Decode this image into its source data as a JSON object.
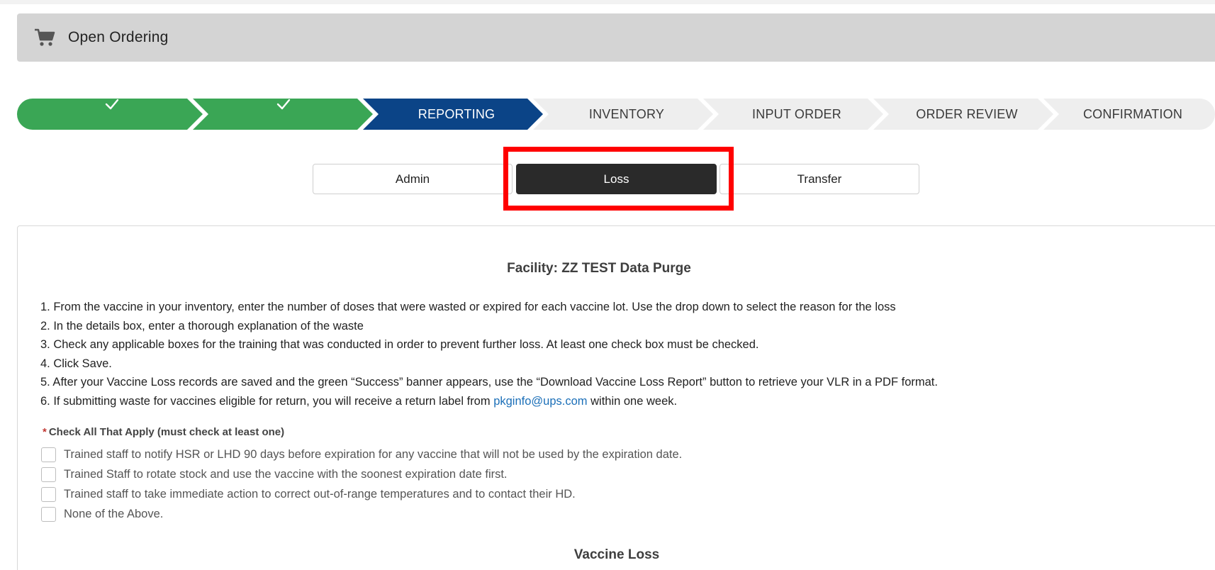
{
  "header": {
    "title": "Open Ordering",
    "icon": "cart-icon"
  },
  "stepper": {
    "steps": [
      {
        "label": "",
        "state": "complete"
      },
      {
        "label": "",
        "state": "complete"
      },
      {
        "label": "REPORTING",
        "state": "active"
      },
      {
        "label": "INVENTORY",
        "state": "upcoming"
      },
      {
        "label": "INPUT ORDER",
        "state": "upcoming"
      },
      {
        "label": "ORDER REVIEW",
        "state": "upcoming"
      },
      {
        "label": "CONFIRMATION",
        "state": "upcoming"
      }
    ],
    "colors": {
      "complete": "#3aa655",
      "active": "#0b4487",
      "upcoming": "#eeeeee"
    }
  },
  "tabs": [
    {
      "label": "Admin",
      "selected": false
    },
    {
      "label": "Loss",
      "selected": true
    },
    {
      "label": "Transfer",
      "selected": false
    }
  ],
  "highlight_color": "#ff0000",
  "main": {
    "facility": "Facility: ZZ TEST Data Purge",
    "instructions": [
      "1. From the vaccine in your inventory, enter the number of doses that were wasted or expired for each vaccine lot. Use the drop down to select the reason for the loss",
      "2. In the details box, enter a thorough explanation of the waste",
      "3. Check any applicable boxes for the training that was conducted in order to prevent further loss. At least one check box must be checked.",
      "4. Click Save.",
      "5. After your Vaccine Loss records are saved and the green “Success” banner appears, use the “Download Vaccine Loss Report” button to retrieve your VLR in a PDF format."
    ],
    "instruction6": {
      "before": "6. If submitting waste for vaccines eligible for return, you will receive a return label from ",
      "link": "pkginfo@ups.com",
      "after": " within one week."
    },
    "checks_heading": {
      "required_mark": "*",
      "text": "Check All That Apply (must check at least one)"
    },
    "checks": [
      "Trained staff to notify HSR or LHD 90 days before expiration for any vaccine that will not be used by the expiration date.",
      "Trained Staff to rotate stock and use the vaccine with the soonest expiration date first.",
      "Trained staff to take immediate action to correct out-of-range temperatures and to contact their HD.",
      "None of the Above."
    ],
    "section_title": "Vaccine Loss"
  }
}
